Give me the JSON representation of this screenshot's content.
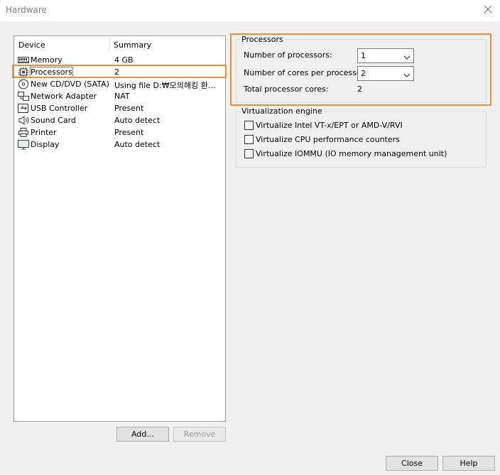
{
  "window": {
    "title": "Hardware"
  },
  "device_list": {
    "header_device": "Device",
    "header_summary": "Summary",
    "items": [
      {
        "name": "Memory",
        "summary": "4 GB",
        "icon": "memory-icon"
      },
      {
        "name": "Processors",
        "summary": "2",
        "icon": "processor-icon",
        "selected": true
      },
      {
        "name": "New CD/DVD (SATA)",
        "summary": "Using file D:₩모의해킹 환경...",
        "icon": "cd-dvd-icon"
      },
      {
        "name": "Network Adapter",
        "summary": "NAT",
        "icon": "network-adapter-icon"
      },
      {
        "name": "USB Controller",
        "summary": "Present",
        "icon": "usb-icon"
      },
      {
        "name": "Sound Card",
        "summary": "Auto detect",
        "icon": "speaker-icon"
      },
      {
        "name": "Printer",
        "summary": "Present",
        "icon": "printer-icon"
      },
      {
        "name": "Display",
        "summary": "Auto detect",
        "icon": "monitor-icon"
      }
    ],
    "add_label": "Add...",
    "remove_label": "Remove"
  },
  "processors": {
    "group_label": "Processors",
    "num_processors_label": "Number of processors:",
    "num_processors_value": "1",
    "cores_label": "Number of cores per processor:",
    "cores_value": "2",
    "total_label": "Total processor cores:",
    "total_value": "2"
  },
  "virtualization": {
    "group_label": "Virtualization engine",
    "options": [
      {
        "label": "Virtualize Intel VT-x/EPT or AMD-V/RVI",
        "checked": false
      },
      {
        "label": "Virtualize CPU performance counters",
        "checked": false
      },
      {
        "label": "Virtualize IOMMU (IO memory management unit)",
        "checked": false
      }
    ]
  },
  "footer": {
    "close_label": "Close",
    "help_label": "Help"
  },
  "colors": {
    "highlight": "#e8913a",
    "background": "#f0f0f0"
  }
}
